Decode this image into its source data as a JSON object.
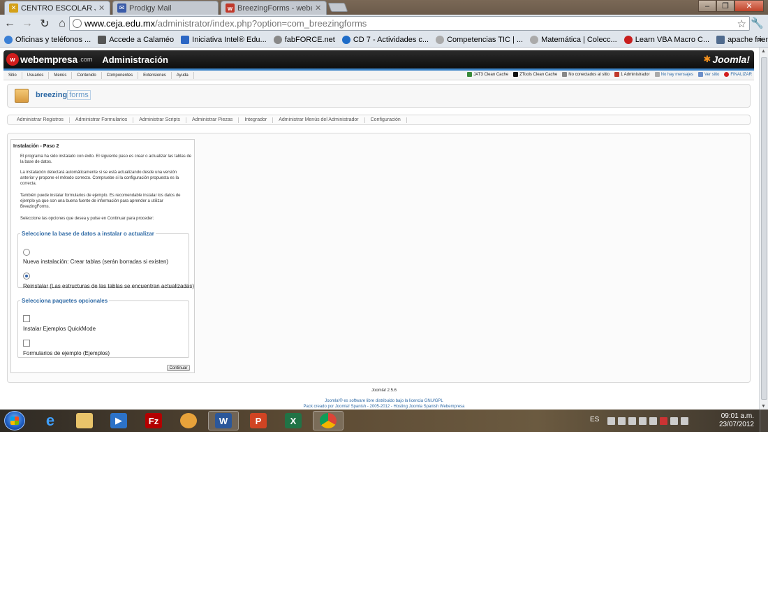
{
  "browser": {
    "tabs": [
      {
        "title": "CENTRO ESCOLAR JUANA",
        "active": true
      },
      {
        "title": "Prodigy Mail",
        "active": false
      },
      {
        "title": "BreezingForms - webempr",
        "active": false
      }
    ],
    "url_host": "www.ceja.edu.mx",
    "url_path": "/administrator/index.php?option=com_breezingforms",
    "bookmarks": [
      "Oficinas y teléfonos ...",
      "Accede a Calaméo",
      "Iniciativa Intel® Edu...",
      "fabFORCE.net",
      "CD 7 - Actividades c...",
      "Competencias TIC | ...",
      "Matemática | Colecc...",
      "Learn VBA Macro C...",
      "apache friends - xa..."
    ]
  },
  "joomla": {
    "brand": "webempresa",
    "brand_suffix": ".com",
    "admin_title": "Administración",
    "joomla_logo": "Joomla!",
    "menu": [
      "Sitio",
      "Usuarios",
      "Menús",
      "Contenido",
      "Componentes",
      "Extensiones",
      "Ayuda"
    ],
    "status": [
      "JAT3 Clean Cache",
      "ZTools Clean Cache",
      "No conectados al sitio",
      "1 Administrador",
      "No hay mensajes",
      "Ver sitio",
      "FINALIZAR"
    ],
    "component_logo_a": "breezing",
    "component_logo_b": "forms",
    "subnav": [
      "Administrar Registros",
      "Administrar Formularios",
      "Administrar Scripts",
      "Administrar Piezas",
      "Integrador",
      "Administrar Menús del Administrador",
      "Configuración"
    ]
  },
  "install": {
    "heading": "Instalación - Paso 2",
    "p1": "El programa ha sido instalado con éxito. El siguiente paso es crear o actualizar las tablas de la base de datos.",
    "p2": "La instalación detectará automáticamente si se está actualizando desde una versión anterior y propone el método correcto. Compruebe si la configuración propuesta es la correcta.",
    "p3": "También puede instalar formularios de ejemplo. Es recomendable instalar los datos de ejemplo ya que son una buena fuente de información para aprender a utilizar BreezingForms.",
    "p4": "Seleccione las opciones que desea y pulse en Continuar para proceder:",
    "db_legend": "Seleccione la base de datos a instalar o actualizar",
    "radio_new": "Nueva instalación: Crear tablas (serán borradas si existen)",
    "radio_reinstall": "Reinstalar (Las estructuras de las tablas se encuentran actualizadas)",
    "pkg_legend": "Selecciona paquetes opcionales",
    "chk_quickmode": "Instalar Ejemplos QuickMode",
    "chk_examples": "Formularios de ejemplo (Ejemplos)",
    "continue_label": "Continuar",
    "selected_option": "reinstall"
  },
  "footer": {
    "version": "Joomla! 2.5.6",
    "license": "Joomla!® es software libre distribuido bajo la licencia GNU/GPL",
    "pack": "Pack creado por Joomla! Spanish - 2005-2012 - Hosting Joomla Spanish Webempresa"
  },
  "taskbar": {
    "lang": "ES",
    "time": "09:01 a.m.",
    "date": "23/07/2012"
  }
}
